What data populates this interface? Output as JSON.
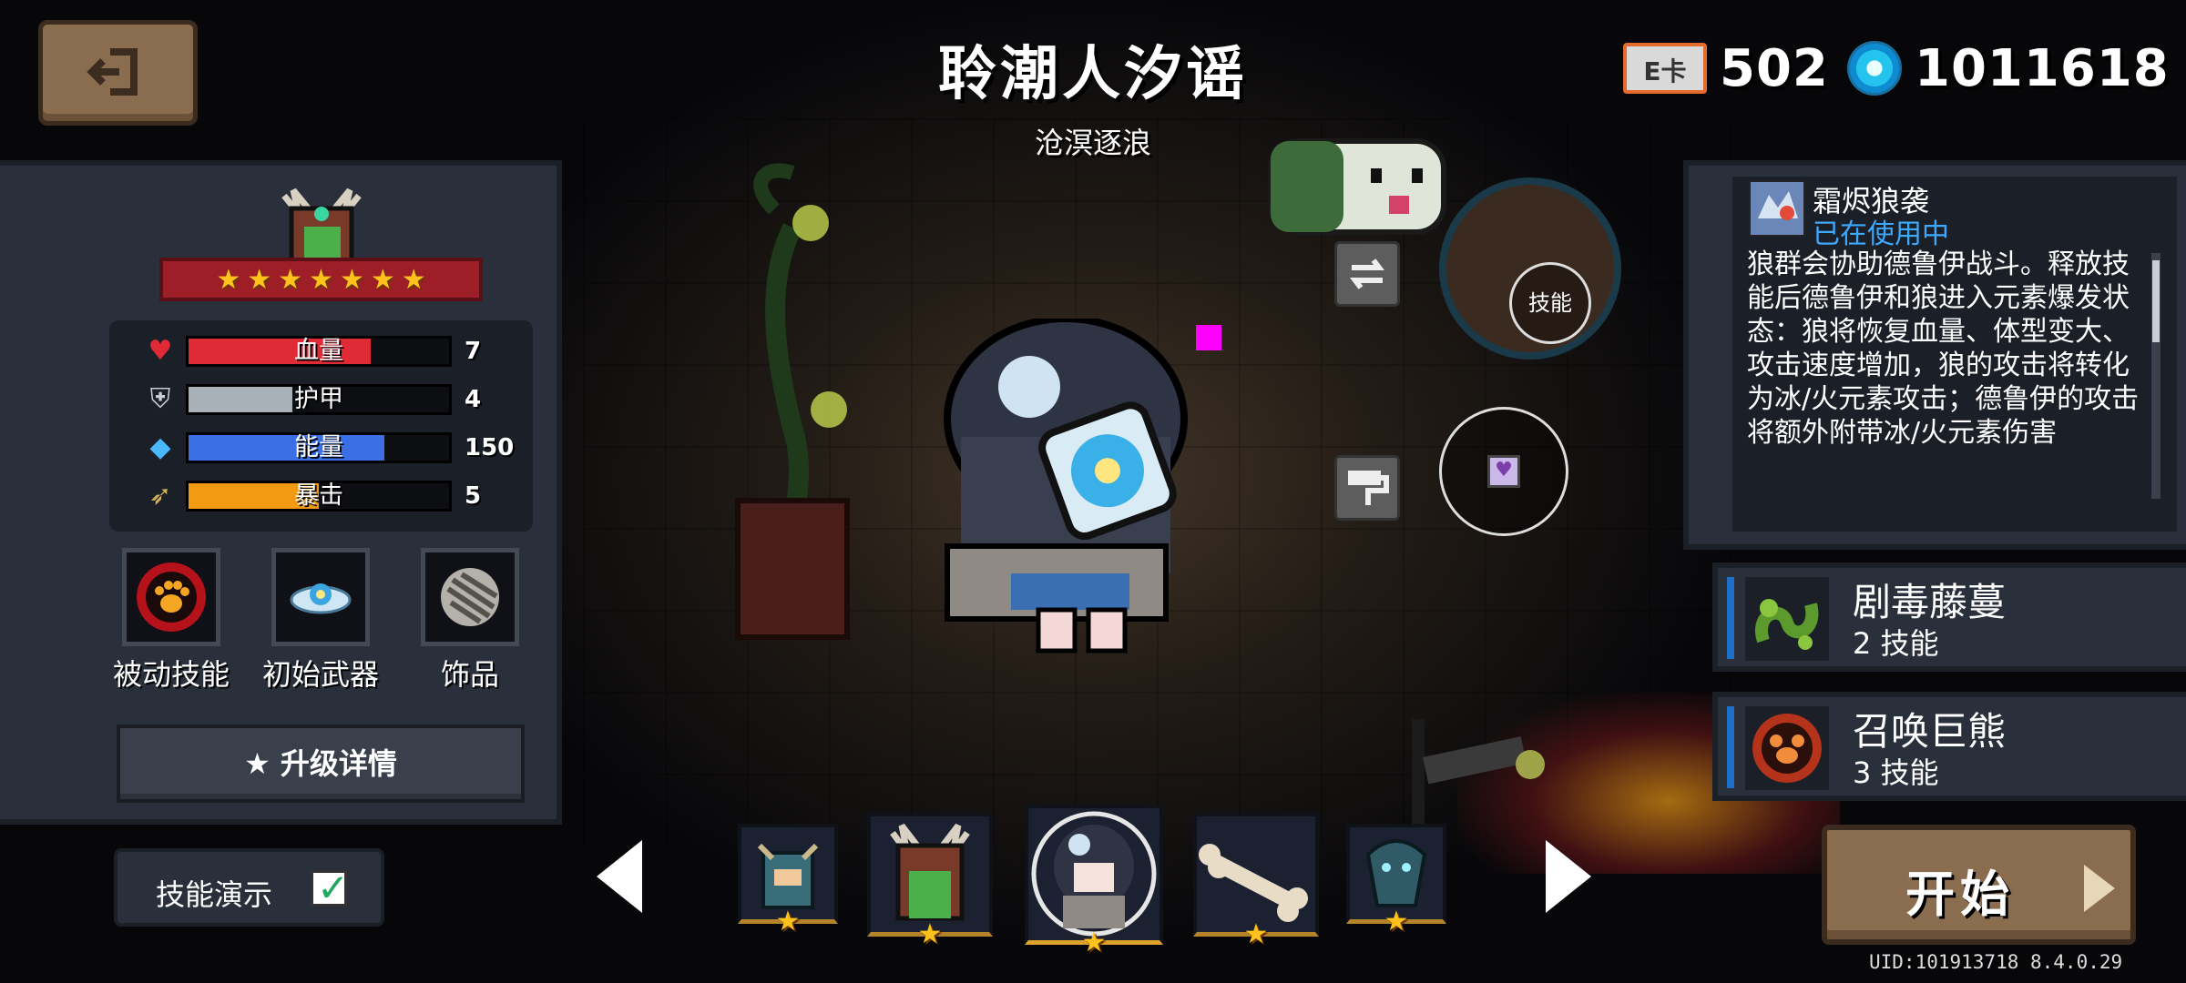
{
  "header": {
    "title": "聆潮人汐谣",
    "subtitle": "沧溟逐浪"
  },
  "currency": {
    "cards_label": "E卡",
    "cards_value": "502",
    "gems_value": "1011618"
  },
  "character": {
    "star_count": 7,
    "stats": [
      {
        "icon": "heart-icon",
        "label": "血量",
        "value": "7",
        "fill": 0.7,
        "color": "#e02b37"
      },
      {
        "icon": "shield-icon",
        "label": "护甲",
        "value": "4",
        "fill": 0.4,
        "color": "#a8b0b8"
      },
      {
        "icon": "energy-icon",
        "label": "能量",
        "value": "150",
        "fill": 0.75,
        "color": "#3c6fe6"
      },
      {
        "icon": "crit-icon",
        "label": "暴击",
        "value": "5",
        "fill": 0.5,
        "color": "#f39a12"
      }
    ],
    "slots": [
      {
        "label": "被动技能",
        "icon": "paw-icon"
      },
      {
        "label": "初始武器",
        "icon": "weapon-icon"
      },
      {
        "label": "饰品",
        "icon": "accessory-icon"
      }
    ],
    "upgrade_label": "★ 升级详情",
    "demo_label": "技能演示",
    "demo_checked": true
  },
  "actions": {
    "skill_label": "技能"
  },
  "skill_detail": {
    "name": "霜烬狼袭",
    "status": "已在使用中",
    "description": "狼群会协助德鲁伊战斗。释放技能后德鲁伊和狼进入元素爆发状态：狼将恢复血量、体型变大、攻击速度增加，狼的攻击将转化为冰/火元素攻击；德鲁伊的攻击将额外附带冰/火元素伤害"
  },
  "skills": [
    {
      "name": "剧毒藤蔓",
      "sub": "2 技能",
      "icon": "vine-icon"
    },
    {
      "name": "召唤巨熊",
      "sub": "3 技能",
      "icon": "bear-icon"
    }
  ],
  "start_label": "开始",
  "uid_text": "UID:101913718 8.4.0.29",
  "colors": {
    "panel": "#2a303b",
    "panel_dark": "#1b2028",
    "wood": "#8a6c4e",
    "gold": "#ffc21c",
    "ribbon": "#9e1e28",
    "status_blue": "#3da9ff"
  }
}
